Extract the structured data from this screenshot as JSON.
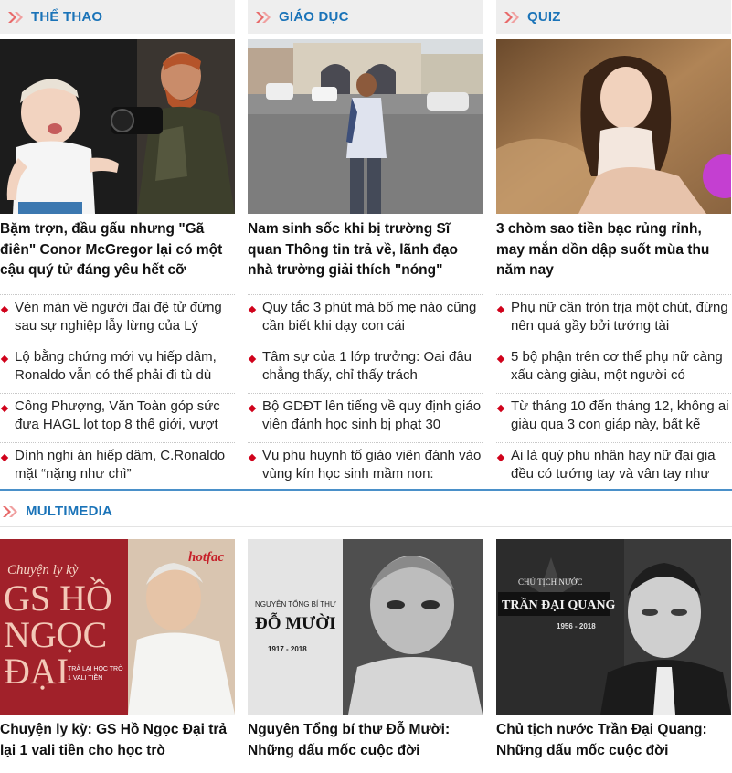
{
  "colors": {
    "accent": "#1a73b8",
    "bullet": "#d0021b",
    "chevron": "#e86a6a",
    "header_bg": "#eeeeee"
  },
  "sections": [
    {
      "title": "THỂ THAO",
      "headline": "Bặm trợn, đầu gấu nhưng \"Gã điên\" Conor McGregor lại có một cậu quý tử đáng yêu hết cỡ",
      "items": [
        "Vén màn về người đại đệ tử đứng sau sự nghiệp lẫy lừng của Lý",
        "Lộ bằng chứng mới vụ hiếp dâm, Ronaldo vẫn có thể phải đi tù dù",
        "Công Phượng, Văn Toàn góp sức đưa HAGL lọt top 8 thế giới, vượt",
        "Dính nghi án hiếp dâm, C.Ronaldo mặt “nặng như chì”"
      ]
    },
    {
      "title": "GIÁO DỤC",
      "headline": "Nam sinh sốc khi bị trường Sĩ quan Thông tin trả về, lãnh đạo nhà trường giải thích \"nóng\"",
      "items": [
        "Quy tắc 3 phút mà bố mẹ nào cũng cần biết khi dạy con cái",
        "Tâm sự của 1 lớp trưởng: Oai đâu chẳng thấy, chỉ thấy trách",
        "Bộ GDĐT lên tiếng về quy định giáo viên đánh học sinh bị phạt 30",
        "Vụ phụ huynh tố giáo viên đánh vào vùng kín học sinh mầm non:"
      ]
    },
    {
      "title": "QUIZ",
      "headline": "3 chòm sao tiền bạc rủng rỉnh, may mắn dồn dập suốt mùa thu năm nay",
      "items": [
        "Phụ nữ cần tròn trịa một chút, đừng nên quá gầy bởi tướng tài",
        "5 bộ phận trên cơ thể phụ nữ càng xấu càng giàu, một người có",
        "Từ tháng 10 đến tháng 12, không ai giàu qua 3 con giáp này, bất kể",
        "Ai là quý phu nhân hay nữ đại gia đều có tướng tay và vân tay như"
      ]
    }
  ],
  "multimedia": {
    "title": "MULTIMEDIA",
    "cards": [
      {
        "title": "Chuyện ly kỳ: GS Hồ Ngọc Đại trả lại 1 vali tiền cho học trò",
        "overlay": {
          "kicker": "Chuyện ly kỳ",
          "line1": "GS HỒ",
          "line2": "NGỌC",
          "line3": "ĐẠI",
          "sub1": "TRẢ LẠI HỌC TRÒ",
          "sub2": "1 VALI TIỀN",
          "brand": "hotfac"
        }
      },
      {
        "title": "Nguyên Tổng bí thư Đỗ Mười: Những dấu mốc cuộc đời",
        "overlay": {
          "kicker": "NGUYÊN TỔNG BÍ THƯ",
          "name": "ĐỖ MƯỜI",
          "years": "1917 - 2018"
        }
      },
      {
        "title": "Chủ tịch nước Trần Đại Quang: Những dấu mốc cuộc đời",
        "overlay": {
          "kicker": "CHỦ TỊCH NƯỚC",
          "name": "TRẦN ĐẠI QUANG",
          "years": "1956 - 2018"
        }
      }
    ]
  }
}
